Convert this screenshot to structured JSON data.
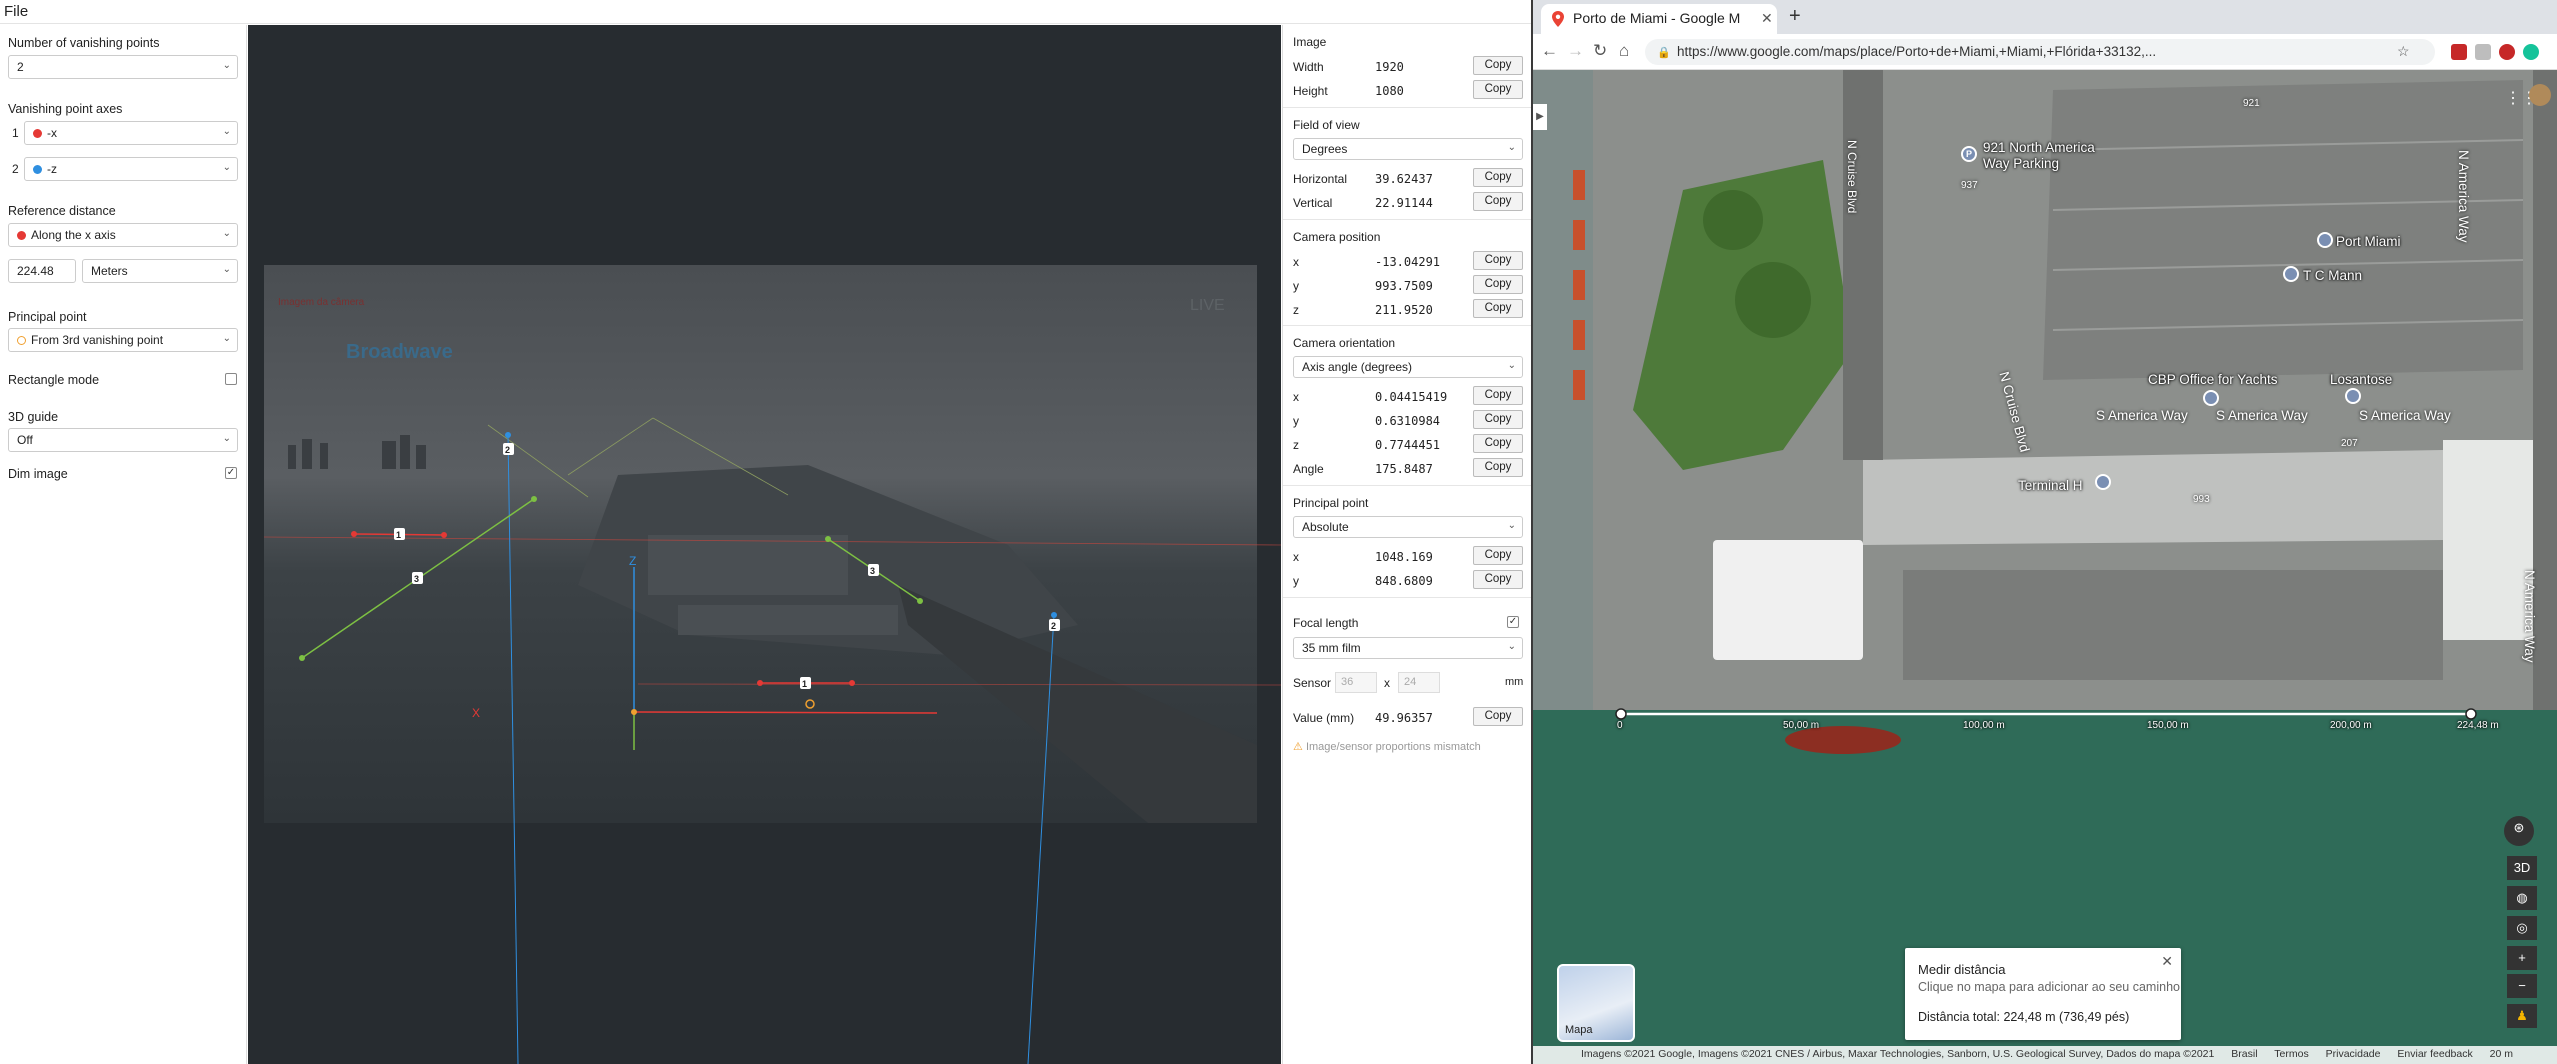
{
  "menu": {
    "file": "File"
  },
  "left": {
    "num_vp_label": "Number of vanishing points",
    "num_vp_value": "2",
    "vp_axes_label": "Vanishing point axes",
    "vp1_num": "1",
    "vp1_value": "-x",
    "vp1_color": "#e53935",
    "vp2_num": "2",
    "vp2_value": "-z",
    "vp2_color": "#2f8fe0",
    "ref_label": "Reference distance",
    "ref_value": "Along the x axis",
    "ref_dist": "224.48",
    "ref_unit": "Meters",
    "pp_label": "Principal point",
    "pp_value": "From 3rd vanishing point",
    "rect_label": "Rectangle mode",
    "rect_checked": false,
    "guide_label": "3D guide",
    "guide_value": "Off",
    "dim_label": "Dim image",
    "dim_checked": true
  },
  "canvas": {
    "overlay_text": "Broadwave",
    "live": "LIVE",
    "cam_text": "Imagem da câmera",
    "axis_z": "Z",
    "axis_x": "X",
    "labels": {
      "vp2_a": "2",
      "vp2_b": "2",
      "l1a": "1",
      "l1b": "1",
      "l3a": "3",
      "l3b": "3"
    }
  },
  "right": {
    "image": {
      "title": "Image",
      "width_k": "Width",
      "width_v": "1920",
      "height_k": "Height",
      "height_v": "1080"
    },
    "fov": {
      "title": "Field of view",
      "unit": "Degrees",
      "h_k": "Horizontal",
      "h_v": "39.62437",
      "v_k": "Vertical",
      "v_v": "22.91144"
    },
    "campos": {
      "title": "Camera position",
      "x_k": "x",
      "x_v": "-13.04291",
      "y_k": "y",
      "y_v": "993.7509",
      "z_k": "z",
      "z_v": "211.9520"
    },
    "orient": {
      "title": "Camera orientation",
      "mode": "Axis angle (degrees)",
      "x_k": "x",
      "x_v": "0.04415419",
      "y_k": "y",
      "y_v": "0.6310984",
      "z_k": "z",
      "z_v": "0.7744451",
      "a_k": "Angle",
      "a_v": "175.8487"
    },
    "pp": {
      "title": "Principal point",
      "mode": "Absolute",
      "x_k": "x",
      "x_v": "1048.169",
      "y_k": "y",
      "y_v": "848.6809"
    },
    "focal": {
      "title": "Focal length",
      "checked": true,
      "mode": "35 mm film",
      "sensor_k": "Sensor",
      "sensor_w": "36",
      "sensor_x": "x",
      "sensor_h": "24",
      "sensor_unit": "mm",
      "value_k": "Value (mm)",
      "value_v": "49.96357",
      "warn": "Image/sensor proportions mismatch"
    },
    "copy": "Copy"
  },
  "browser": {
    "tab_title": "Porto de Miami - Google M",
    "url": "https://www.google.com/maps/place/Porto+de+Miami,+Miami,+Flórida+33132,...",
    "map": {
      "pois": {
        "parking": "921 North America Way Parking",
        "port": "Port Miami",
        "tc": "T C Mann",
        "cbp": "CBP Office for Yachts",
        "los": "Losantose",
        "terminal": "Terminal H"
      },
      "roads": {
        "sam1": "S America Way",
        "sam2": "S America Way",
        "sam3": "S America Way",
        "nam1": "N America Way",
        "nam2": "N America Way",
        "ncruise": "N Cruise Blvd",
        "ncruise2": "N Cruise Blvd",
        "nums": {
          "a": "921",
          "b": "937",
          "c": "207",
          "d": "993"
        }
      },
      "scale": {
        "s0": "0",
        "s50": "50,00 m",
        "s100": "100,00 m",
        "s150": "150,00 m",
        "s200": "200,00 m",
        "s224": "224,48 m"
      },
      "measure": {
        "title": "Medir distância",
        "sub": "Clique no mapa para adicionar ao seu caminho",
        "total": "Distância total: 224,48 m (736,49 pés)"
      },
      "thumb": "Mapa",
      "ctrl_3d": "3D",
      "footer": [
        "Imagens ©2021 Google, Imagens ©2021 CNES / Airbus, Maxar Technologies, Sanborn, U.S. Geological Survey, Dados do mapa ©2021",
        "Brasil",
        "Termos",
        "Privacidade",
        "Enviar feedback",
        "20 m"
      ]
    }
  }
}
